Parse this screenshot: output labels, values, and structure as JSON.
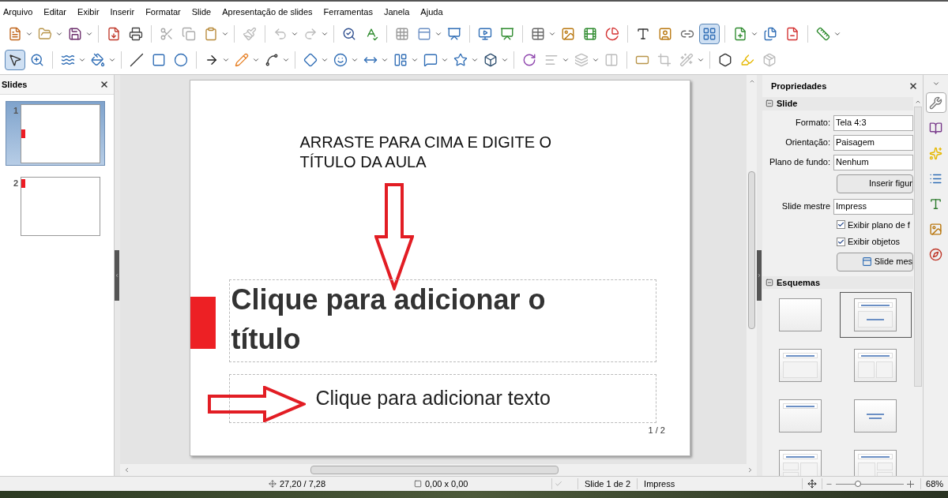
{
  "menu": [
    "Arquivo",
    "Editar",
    "Exibir",
    "Inserir",
    "Formatar",
    "Slide",
    "Apresentação de slides",
    "Ferramentas",
    "Janela",
    "Ajuda"
  ],
  "standard_toolbar": {
    "layout_button_selected": true
  },
  "drawing_toolbar": {
    "select_tool_selected": true
  },
  "slides_panel": {
    "title": "Slides",
    "slides": [
      {
        "number": "1",
        "selected": true,
        "kind": "mark-middle"
      },
      {
        "number": "2",
        "selected": false,
        "kind": "mark-top"
      }
    ]
  },
  "slide": {
    "annotation": "ARRASTE PARA CIMA E DIGITE O TÍTULO DA AULA",
    "title_placeholder": "Clique para adicionar o título",
    "text_placeholder": "Clique para adicionar texto",
    "page_number": "1 / 2"
  },
  "properties": {
    "title": "Propriedades",
    "slide_section": {
      "title": "Slide",
      "fields": [
        {
          "label": "Formato:",
          "value": "Tela 4:3"
        },
        {
          "label": "Orientação:",
          "value": "Paisagem"
        },
        {
          "label": "Plano de fundo:",
          "value": "Nenhum"
        }
      ],
      "insert_button": "Inserir figur",
      "master_label": "Slide mestre",
      "master_value": "Impress",
      "checkboxes": [
        {
          "label": "Exibir plano de f",
          "checked": true
        },
        {
          "label": "Exibir objetos",
          "checked": true
        }
      ],
      "master_button": "Slide mes"
    },
    "layouts_section": {
      "title": "Esquemas",
      "layouts": [
        {
          "kind": "blank",
          "selected": false
        },
        {
          "kind": "title-subtitle",
          "selected": true
        },
        {
          "kind": "title-content",
          "selected": false
        },
        {
          "kind": "title-two-content",
          "selected": false
        },
        {
          "kind": "title-only",
          "selected": false
        },
        {
          "kind": "centered-text",
          "selected": false
        },
        {
          "kind": "title-two-left",
          "selected": false
        },
        {
          "kind": "title-two-right",
          "selected": false
        }
      ]
    }
  },
  "deck_tabs": [
    {
      "selected": true
    },
    {
      "selected": false
    },
    {
      "selected": false
    },
    {
      "selected": false
    },
    {
      "selected": false
    },
    {
      "selected": false
    },
    {
      "selected": false
    }
  ],
  "status_bar": {
    "position": "27,20 / 7,28",
    "size": "0,00 x 0,00",
    "slide": "Slide 1 de 2",
    "master": "Impress",
    "zoom": {
      "level": 0.32,
      "reading": "68%"
    }
  }
}
